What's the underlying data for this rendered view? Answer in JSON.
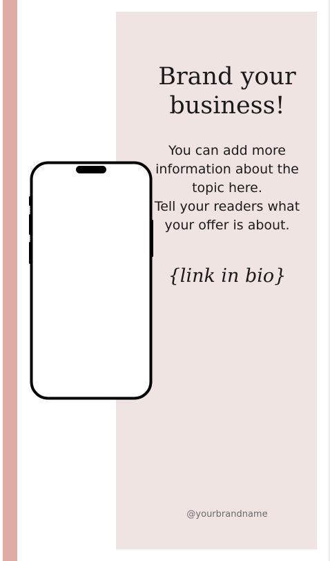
{
  "headline": {
    "line1": "Brand your",
    "line2": "business!"
  },
  "body": {
    "line1": "You can add more information about the topic here.",
    "line2": "Tell your readers what your offer is about."
  },
  "link": "{link in bio}",
  "handle": "@yourbrandname",
  "colors": {
    "stripe": "#dfaca5",
    "panel": "#f0e4e2",
    "text": "#1a1a1a"
  },
  "icons": {
    "phone": "smartphone-mockup-icon"
  }
}
